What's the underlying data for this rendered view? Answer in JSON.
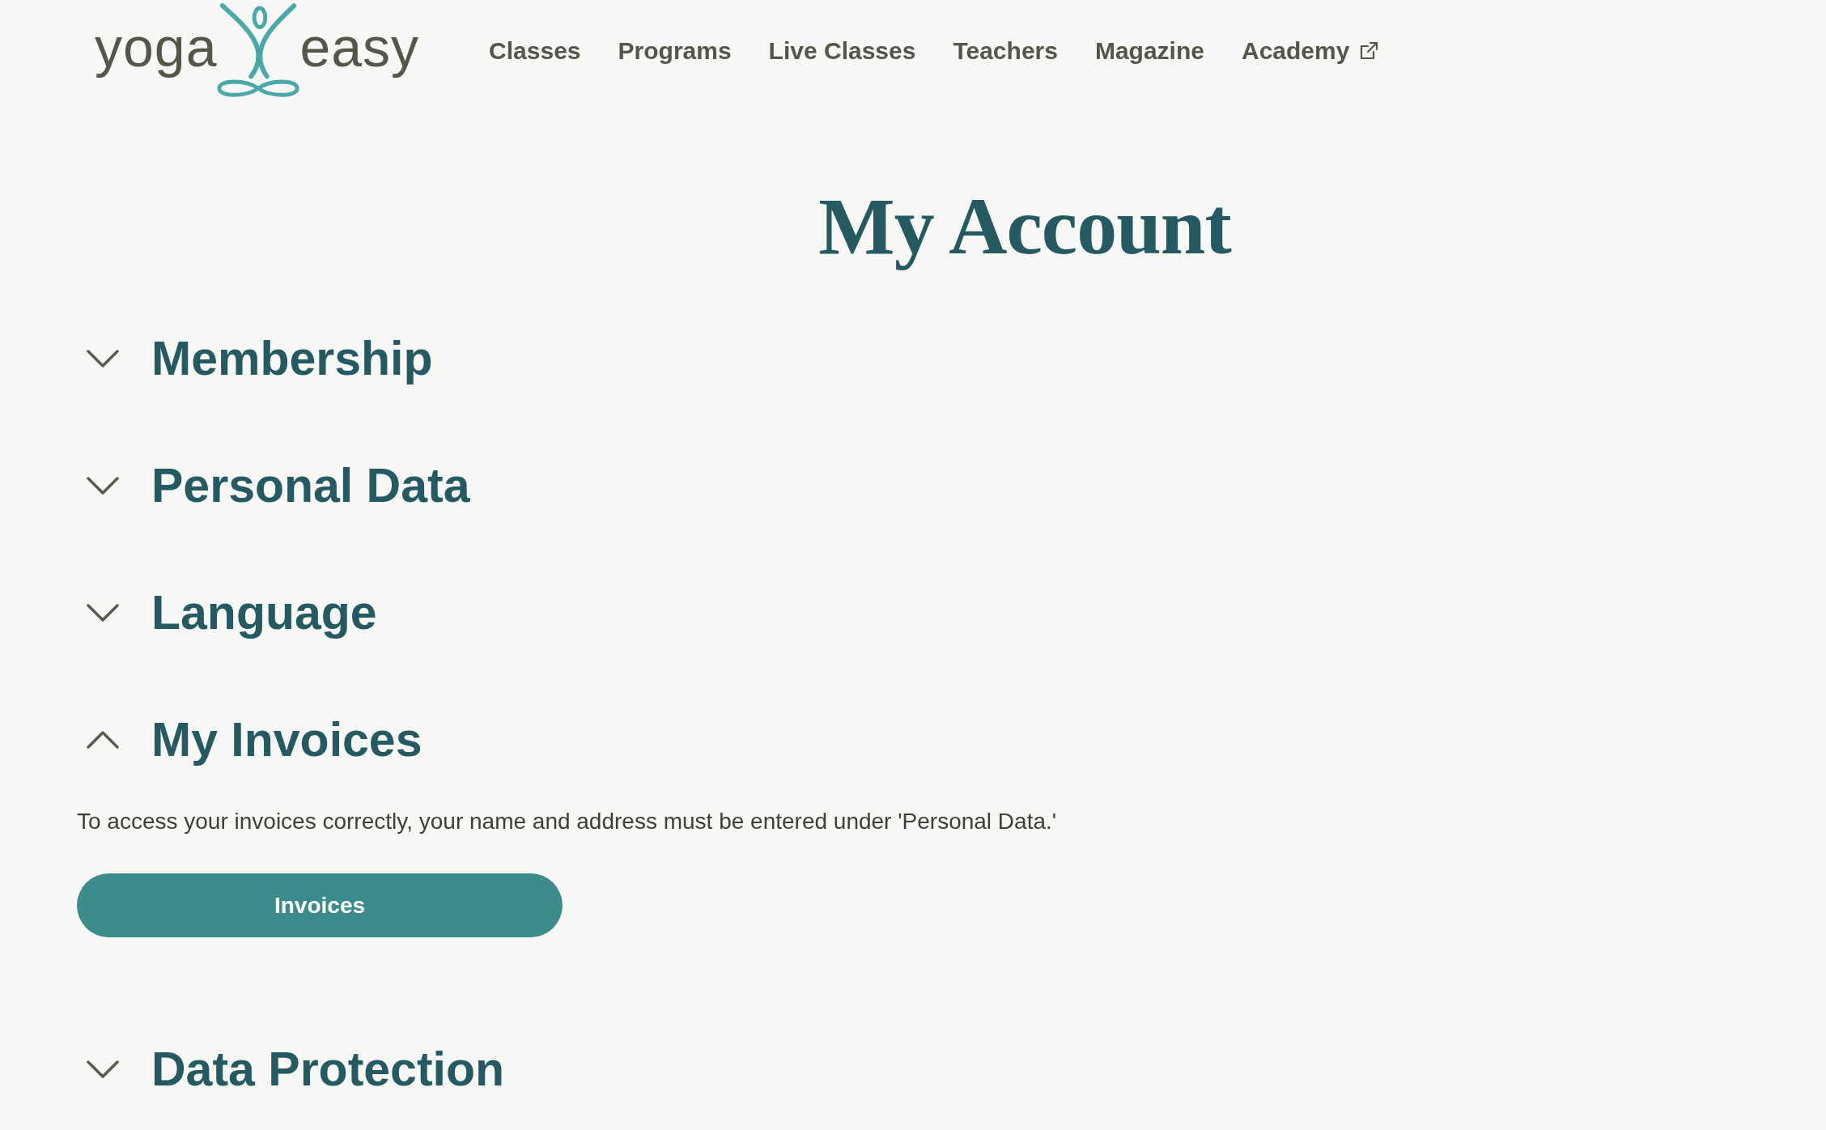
{
  "header": {
    "logo": {
      "word_left": "yoga",
      "word_right": "easy"
    },
    "nav": [
      {
        "label": "Classes",
        "external": false
      },
      {
        "label": "Programs",
        "external": false
      },
      {
        "label": "Live Classes",
        "external": false
      },
      {
        "label": "Teachers",
        "external": false
      },
      {
        "label": "Magazine",
        "external": false
      },
      {
        "label": "Academy",
        "external": true
      }
    ]
  },
  "page_title": "My Account",
  "sections": [
    {
      "title": "Membership",
      "expanded": false
    },
    {
      "title": "Personal Data",
      "expanded": false
    },
    {
      "title": "Language",
      "expanded": false
    },
    {
      "title": "My Invoices",
      "expanded": true,
      "body": {
        "text": "To access your invoices correctly, your name and address must be entered under 'Personal Data.'",
        "button": "Invoices"
      }
    },
    {
      "title": "Data Protection",
      "expanded": false
    }
  ]
}
